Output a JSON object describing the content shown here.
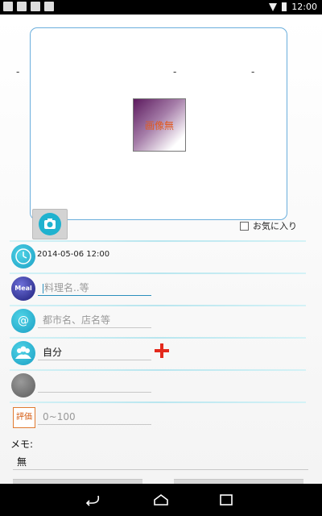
{
  "status_bar": {
    "time": "12:00",
    "left_icons": [
      "image-icon",
      "mail-icon",
      "notification-icon",
      "app-icon"
    ],
    "right_icons": [
      "wifi-icon",
      "battery-icon"
    ]
  },
  "image_area": {
    "placeholder_text": "画像無",
    "dash_left": "-",
    "dash_middle": "-",
    "dash_right": "-"
  },
  "camera_button": {
    "icon": "camera-icon"
  },
  "favorite": {
    "label": "お気に入り",
    "checked": false
  },
  "rows": {
    "datetime": {
      "value": "2014-05-06 12:00",
      "icon": "clock-icon"
    },
    "meal": {
      "icon_text": "Meal",
      "placeholder": "料理名..等"
    },
    "place": {
      "icon_text": "@",
      "placeholder": "都市名、店名等"
    },
    "people": {
      "value": "自分",
      "icon": "people-icon"
    },
    "extra": {
      "value": "",
      "icon": "gray-circle-icon"
    },
    "rating": {
      "icon_text": "評価",
      "placeholder": "0~100"
    }
  },
  "memo": {
    "label": "メモ:",
    "value": "無"
  },
  "nav_bar": {
    "icons": [
      "back-icon",
      "home-icon",
      "recent-apps-icon"
    ]
  },
  "colors": {
    "accent": "#1fb2cf",
    "frame": "#6aaedc",
    "plus": "#e3291c"
  }
}
